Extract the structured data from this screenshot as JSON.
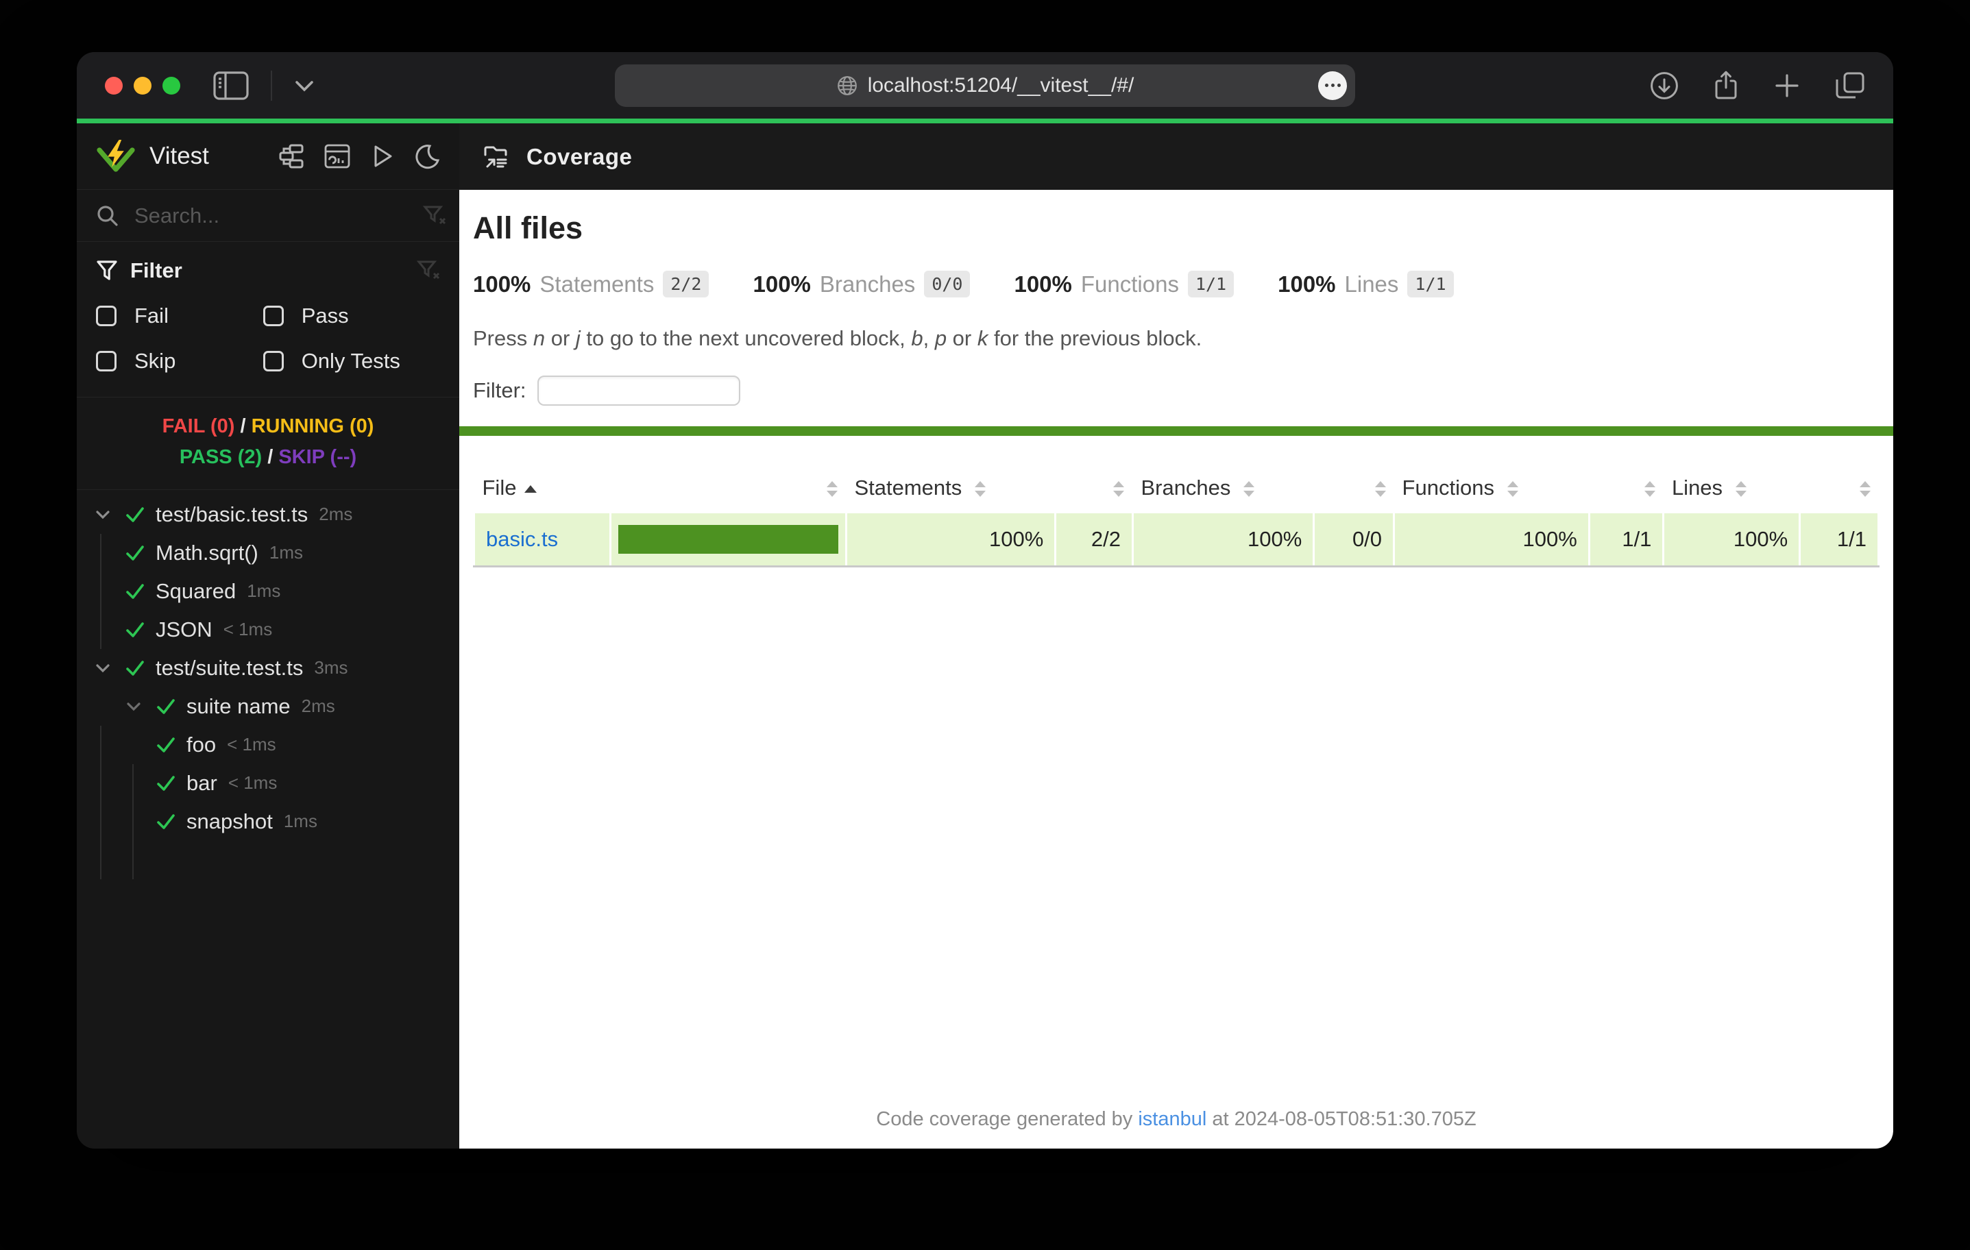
{
  "browser": {
    "url": "localhost:51204/__vitest__/#/",
    "traffic_colors": {
      "close": "#ff5f57",
      "minimize": "#febc2e",
      "zoom": "#28c840"
    },
    "icons": [
      "sidebar-toggle",
      "chevron-down",
      "globe",
      "ellipsis",
      "download",
      "share",
      "new-tab",
      "tab-overview"
    ]
  },
  "colors": {
    "accent_green_line": "#2ec158",
    "coverage_green": "#4d9221",
    "coverage_row_bg": "#e6f5d0",
    "fail_red": "#f04747",
    "running_yellow": "#f5bd17",
    "pass_green": "#27c05d",
    "skip_purple": "#7e3dbd",
    "file_link_blue": "#1b6fd0",
    "vitest_logo_green": "#54a82c",
    "vitest_logo_yellow": "#fcc72b"
  },
  "sidebar": {
    "title": "Vitest",
    "header_icons": [
      "tree-view",
      "dashboard",
      "run-all",
      "dark-mode-toggle"
    ],
    "search_placeholder": "Search...",
    "filter": {
      "title": "Filter",
      "checkboxes": [
        "Fail",
        "Pass",
        "Skip",
        "Only Tests"
      ]
    },
    "status": {
      "fail": "FAIL (0)",
      "sep1": "/",
      "running": "RUNNING (0)",
      "pass": "PASS (2)",
      "sep2": "/",
      "skip": "SKIP (--)"
    },
    "tree": [
      {
        "label": "test/basic.test.ts",
        "duration": "2ms"
      },
      {
        "label": "Math.sqrt()",
        "duration": "1ms"
      },
      {
        "label": "Squared",
        "duration": "1ms"
      },
      {
        "label": "JSON",
        "duration": "< 1ms"
      },
      {
        "label": "test/suite.test.ts",
        "duration": "3ms"
      },
      {
        "label": "suite name",
        "duration": "2ms"
      },
      {
        "label": "foo",
        "duration": "< 1ms"
      },
      {
        "label": "bar",
        "duration": "< 1ms"
      },
      {
        "label": "snapshot",
        "duration": "1ms"
      }
    ]
  },
  "main": {
    "header_title": "Coverage",
    "page_title": "All files",
    "stats": [
      {
        "pct": "100%",
        "label": "Statements",
        "frac": "2/2"
      },
      {
        "pct": "100%",
        "label": "Branches",
        "frac": "0/0"
      },
      {
        "pct": "100%",
        "label": "Functions",
        "frac": "1/1"
      },
      {
        "pct": "100%",
        "label": "Lines",
        "frac": "1/1"
      }
    ],
    "hint": {
      "t1": "Press ",
      "k1": "n",
      "t2": " or ",
      "k2": "j",
      "t3": " to go to the next uncovered block, ",
      "k3": "b",
      "t4": ", ",
      "k4": "p",
      "t5": " or ",
      "k5": "k",
      "t6": " for the previous block."
    },
    "filter_label": "Filter:",
    "filter_value": "",
    "table": {
      "headers": {
        "file": "File",
        "statements": "Statements",
        "branches": "Branches",
        "functions": "Functions",
        "lines": "Lines"
      },
      "rows": [
        {
          "file": "basic.ts",
          "bar_style": "width:100%",
          "statements_pct": "100%",
          "statements": "2/2",
          "branches_pct": "100%",
          "branches": "0/0",
          "functions_pct": "100%",
          "functions": "1/1",
          "lines_pct": "100%",
          "lines": "1/1"
        }
      ]
    },
    "footer": {
      "prefix": "Code coverage generated by ",
      "link": "istanbul",
      "suffix": " at 2024-08-05T08:51:30.705Z"
    }
  }
}
